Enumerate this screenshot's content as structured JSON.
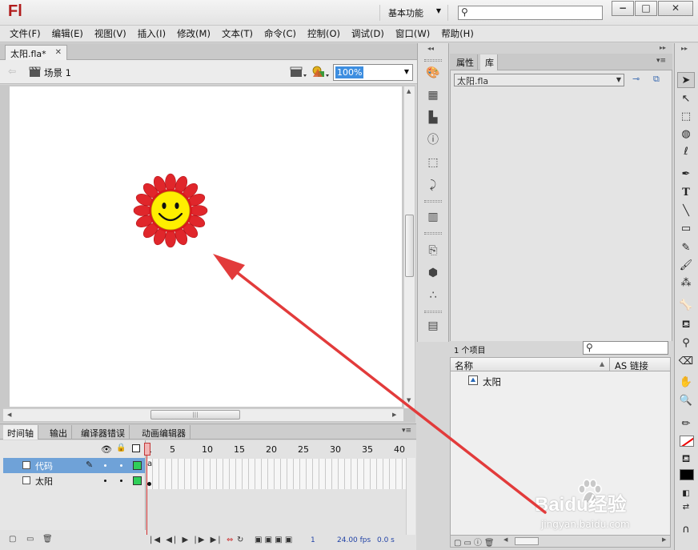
{
  "window": {
    "logo": "Fl",
    "workspace": "基本功能",
    "min": "−",
    "max": "□",
    "close": "✕"
  },
  "menu": [
    "文件(F)",
    "编辑(E)",
    "视图(V)",
    "插入(I)",
    "修改(M)",
    "文本(T)",
    "命令(C)",
    "控制(O)",
    "调试(D)",
    "窗口(W)",
    "帮助(H)"
  ],
  "document": {
    "tab": "太阳.fla*",
    "close": "✕",
    "scene": "场景 1",
    "zoom": "100%"
  },
  "timeline": {
    "tabs": [
      "时间轴",
      "输出",
      "编译器错误",
      "动画编辑器"
    ],
    "frame_numbers": [
      "1",
      "5",
      "10",
      "15",
      "20",
      "25",
      "30",
      "35",
      "40"
    ],
    "layers": [
      {
        "name": "代码",
        "selected": true
      },
      {
        "name": "太阳",
        "selected": false
      }
    ],
    "status": {
      "frame": "1",
      "fps": "24.00 fps",
      "time": "0.0 s"
    }
  },
  "library": {
    "tabs": [
      "属性",
      "库"
    ],
    "file": "太阳.fla",
    "count": "1 个项目",
    "columns": {
      "name": "名称",
      "linkage": "AS 链接"
    },
    "items": [
      {
        "name": "太阳"
      }
    ]
  },
  "watermark": {
    "brand": "Baidu经验",
    "url": "jingyan.baidu.com"
  },
  "colors": {
    "sun_petal": "#e0262b",
    "sun_face": "#ffee00",
    "arrow": "#e23b3b",
    "selection": "#6fa2d8"
  }
}
